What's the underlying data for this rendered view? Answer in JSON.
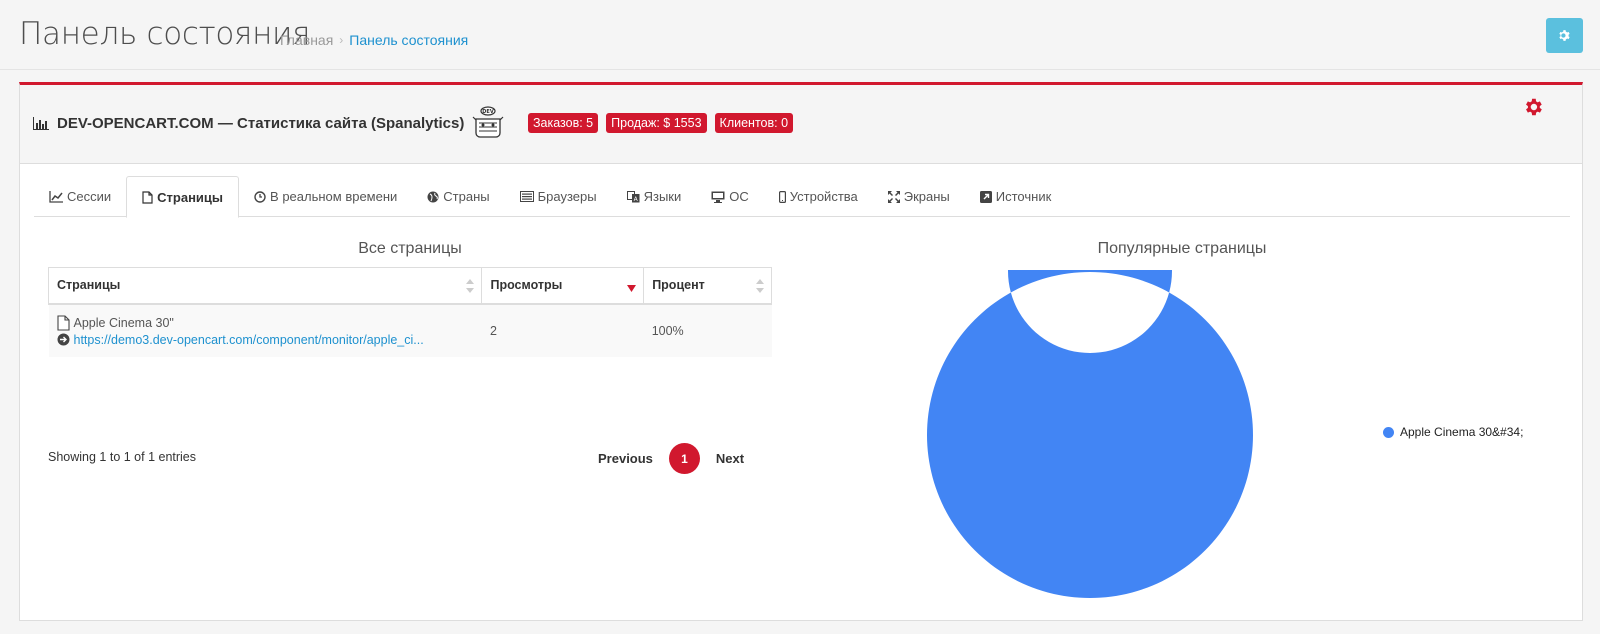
{
  "header": {
    "title": "Панель состояния",
    "breadcrumb": {
      "home": "Главная",
      "separator": "›",
      "current": "Панель состояния"
    }
  },
  "panel": {
    "title": "DEV-OPENCART.COM — Статистика сайта (Spanalytics)",
    "logo_text": "DEV",
    "badges": {
      "orders": "Заказов: 5",
      "sales": "Продаж: $ 1553",
      "customers": "Клиентов: 0"
    }
  },
  "tabs": [
    {
      "label": "Сессии",
      "icon": "line-chart-icon"
    },
    {
      "label": "Страницы",
      "icon": "file-icon",
      "active": true
    },
    {
      "label": "В реальном времени",
      "icon": "clock-icon"
    },
    {
      "label": "Страны",
      "icon": "globe-icon"
    },
    {
      "label": "Браузеры",
      "icon": "list-icon"
    },
    {
      "label": "Языки",
      "icon": "language-icon"
    },
    {
      "label": "ОС",
      "icon": "desktop-icon"
    },
    {
      "label": "Устройства",
      "icon": "mobile-icon"
    },
    {
      "label": "Экраны",
      "icon": "expand-icon"
    },
    {
      "label": "Источник",
      "icon": "external-icon"
    }
  ],
  "pages_table": {
    "title": "Все страницы",
    "columns": [
      "Страницы",
      "Просмотры",
      "Процент"
    ],
    "rows": [
      {
        "name": "Apple Cinema 30\"",
        "url": "https://demo3.dev-opencart.com/component/monitor/apple_ci...",
        "views": "2",
        "percent": "100%"
      }
    ],
    "info": "Showing 1 to 1 of 1 entries",
    "pagination": {
      "previous": "Previous",
      "current": "1",
      "next": "Next"
    }
  },
  "popular": {
    "title": "Популярные страницы"
  },
  "chart_data": {
    "type": "pie",
    "title": "Популярные страницы",
    "labels": [
      "Apple Cinema 30&#34;"
    ],
    "values": [
      2
    ],
    "colors": [
      "#4285f4"
    ],
    "donut": true,
    "legend": "right"
  },
  "colors": {
    "accent": "#d1182e",
    "link": "#1e91cf",
    "info_button": "#5bc0de",
    "slice": "#4285f4"
  }
}
